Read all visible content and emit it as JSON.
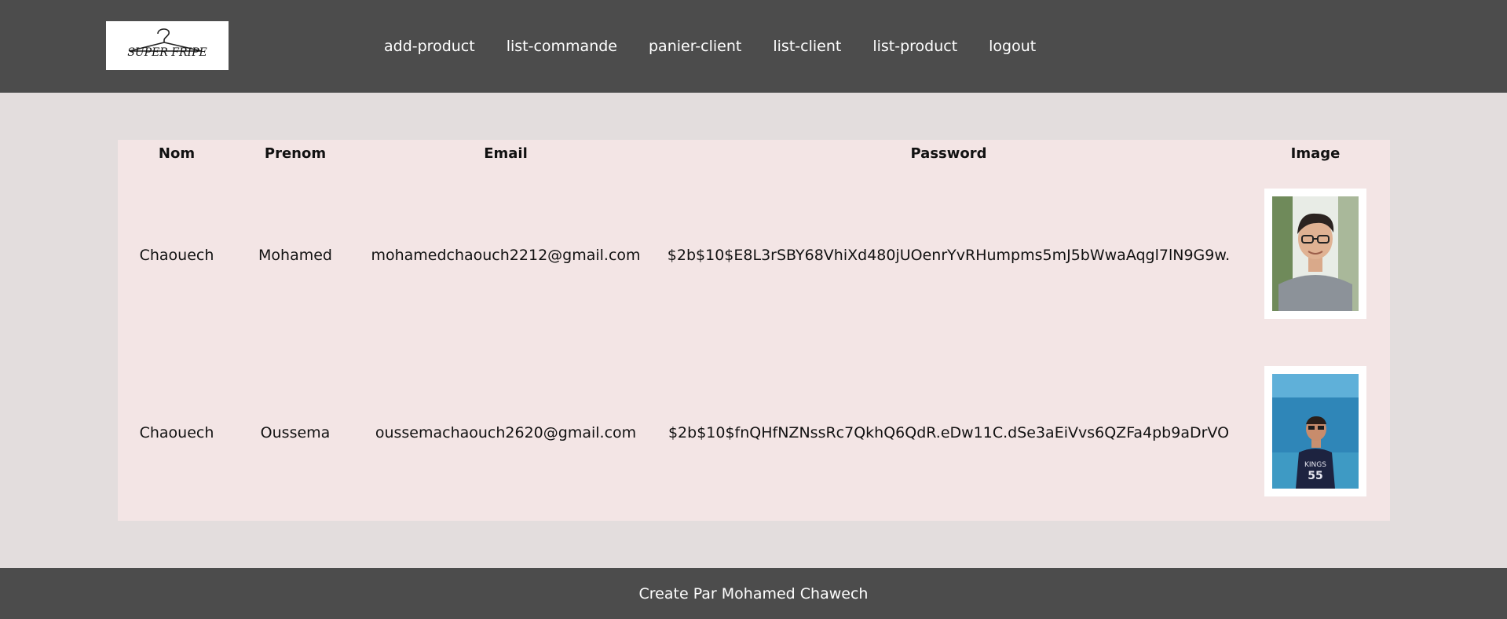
{
  "brand": {
    "logo_text": "SUPER FRIPE"
  },
  "nav": [
    {
      "label": "add-product"
    },
    {
      "label": "list-commande"
    },
    {
      "label": "panier-client"
    },
    {
      "label": "list-client"
    },
    {
      "label": "list-product"
    },
    {
      "label": "logout"
    }
  ],
  "table": {
    "headers": [
      "Nom",
      "Prenom",
      "Email",
      "Password",
      "Image"
    ],
    "rows": [
      {
        "nom": "Chaouech",
        "prenom": "Mohamed",
        "email": "mohamedchaouch2212@gmail.com",
        "password": "$2b$10$E8L3rSBY68VhiXd480jUOenrYvRHumpms5mJ5bWwaAqgl7lN9G9w.",
        "image": "user-photo-mohamed"
      },
      {
        "nom": "Chaouech",
        "prenom": "Oussema",
        "email": "oussemachaouch2620@gmail.com",
        "password": "$2b$10$fnQHfNZNssRc7QkhQ6QdR.eDw11C.dSe3aEiVvs6QZFa4pb9aDrVO",
        "image": "user-photo-oussema"
      }
    ]
  },
  "footer": {
    "text": "Create Par Mohamed Chawech"
  }
}
